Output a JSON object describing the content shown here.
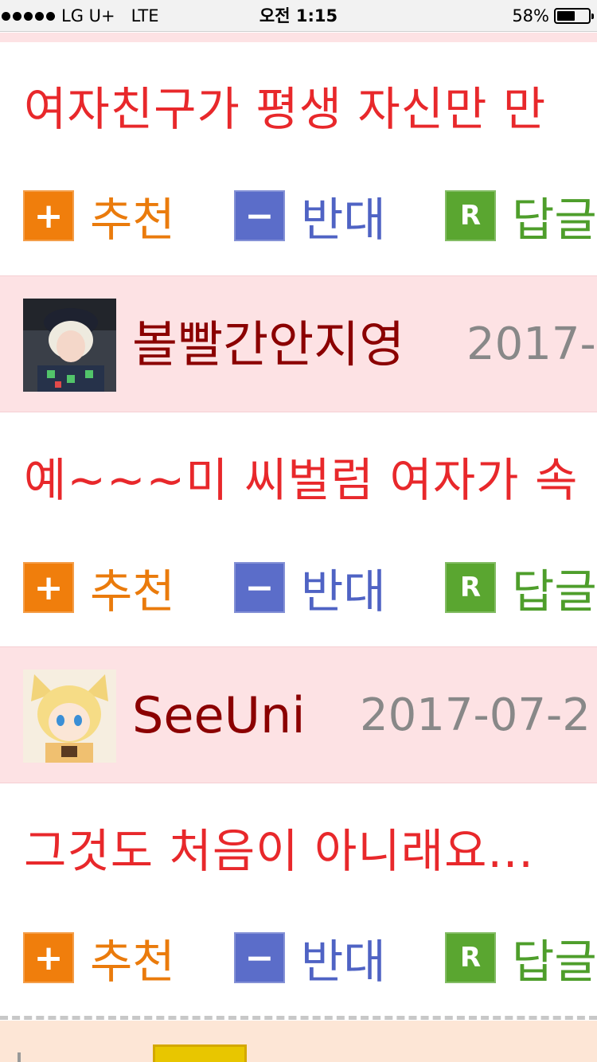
{
  "status_bar": {
    "carrier": "LG U+",
    "network": "LTE",
    "time": "오전 1:15",
    "battery_percent": "58%",
    "battery_level": 0.58
  },
  "comments": [
    {
      "text": "여자친구가 평생 자신만 만",
      "actions": {
        "recommend": "추천",
        "oppose": "반대",
        "reply": "답글"
      }
    },
    {
      "author": "볼빨간안지영",
      "date": "2017-",
      "avatar_icon": "user-avatar-icon",
      "text": "예~~~미 씨벌럼 여자가 속",
      "actions": {
        "recommend": "추천",
        "oppose": "반대",
        "reply": "답글"
      }
    },
    {
      "author": "SeeUni",
      "date": "2017-07-2",
      "avatar_icon": "user-avatar-icon",
      "text": "그것도 처음이 아니래요...",
      "actions": {
        "recommend": "추천",
        "oppose": "반대",
        "reply": "답글"
      }
    }
  ],
  "action_icons": {
    "plus": "+",
    "minus": "−",
    "reply": "R"
  },
  "colors": {
    "comment_text": "#e8282b",
    "author_name": "#8b0000",
    "header_bg": "#fde2e4",
    "recommend": "#f07e0c",
    "oppose": "#5b6dc9",
    "reply": "#5aa630"
  }
}
